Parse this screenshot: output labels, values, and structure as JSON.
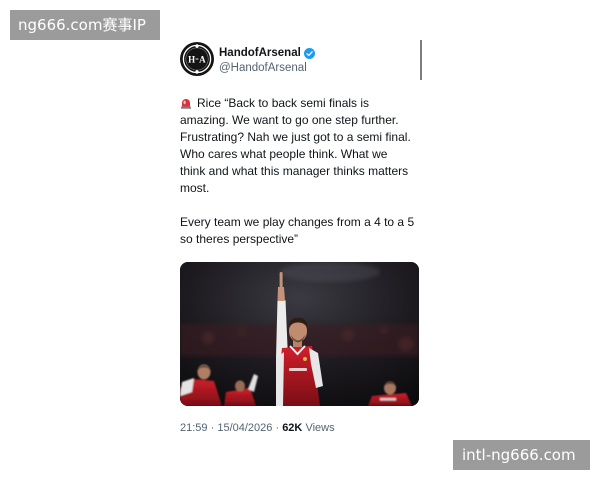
{
  "watermarks": {
    "top_left": "ng666.com赛事IP",
    "bottom_right": "intl-ng666.com"
  },
  "tweet": {
    "author": {
      "display_name": "HandofArsenal",
      "handle": "@HandofArsenal",
      "verified_icon": "verified-badge-icon",
      "avatar_logo": {
        "left_letter": "H",
        "right_letter": "A"
      }
    },
    "lead_icon": "police-car-light-icon",
    "paragraphs": [
      [
        "Rice “Back to back semi finals is",
        "amazing. We want to go one step further.",
        "Frustrating? Nah we just got to a semi final.",
        "Who cares what people think. What we",
        "think and what this manager thinks matters",
        "most."
      ],
      [
        "Every team we play changes from a 4 to a 5",
        "so theres perspective”"
      ]
    ],
    "meta": {
      "time": "21:59",
      "separator": "·",
      "date": "15/04/2026",
      "views_count": "62K",
      "views_label": "Views"
    }
  },
  "colors": {
    "text_primary": "#0f1419",
    "text_secondary": "#536471",
    "verified_blue": "#1d9bf0",
    "watermark_bg": "#9b9b9b",
    "siren_red": "#e0303a",
    "kit_red": "#d01f2b"
  }
}
